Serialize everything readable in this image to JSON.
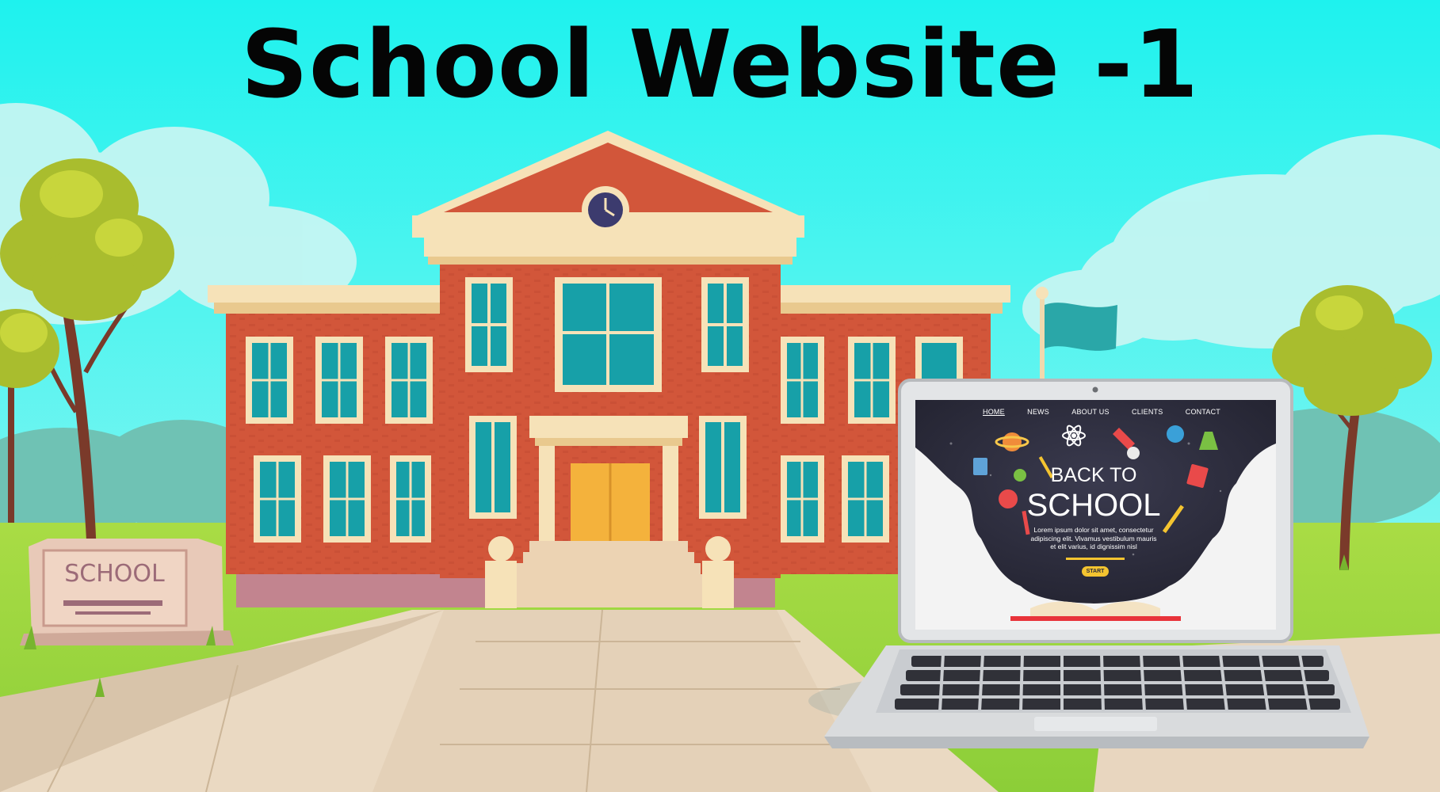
{
  "title": "School Website -1",
  "sign": {
    "text": "SCHOOL"
  },
  "laptop": {
    "nav": [
      "HOME",
      "NEWS",
      "ABOUT US",
      "CLIENTS",
      "CONTACT"
    ],
    "hero": {
      "line1": "BACK TO",
      "line2": "SCHOOL",
      "body": "Lorem ipsum dolor sit amet, consectetur adipiscing elit. Vivamus vestibulum mauris et elit varius, id dignissim nisl",
      "button": "START"
    }
  },
  "colors": {
    "sky_top": "#1ef2ee",
    "sky_bottom": "#9ff6f0",
    "brick": "#d2563a",
    "trim": "#f6e2b8",
    "window_glass": "#17a0a8",
    "door": "#f4b23c",
    "grass": "#96d43c",
    "path": "#ead9c2",
    "screen_bg": "#2b2b3a",
    "accent_yellow": "#f4c430",
    "flag": "#2aa7a8"
  }
}
